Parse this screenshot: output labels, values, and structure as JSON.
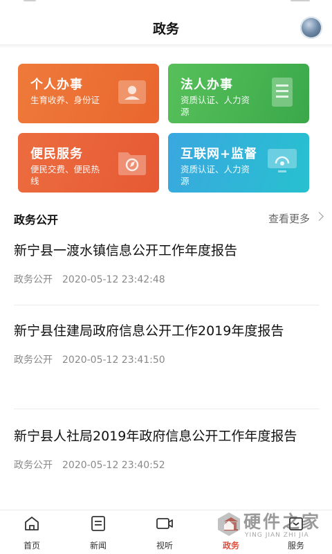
{
  "header": {
    "title": "政务"
  },
  "cards": [
    {
      "title": "个人办事",
      "subtitle": "生育收养、身份证",
      "icon": "id-card-icon",
      "color": "#ec6f35"
    },
    {
      "title": "法人办事",
      "subtitle": "资质认证、人力资源",
      "icon": "document-icon",
      "color": "#4ab552"
    },
    {
      "title": "便民服务",
      "subtitle": "便民交费、便民热线",
      "icon": "folder-compass-icon",
      "color": "#e8613a"
    },
    {
      "title": "互联网+监督",
      "subtitle": "资质认证、人力资源",
      "icon": "monitor-icon",
      "color": "#31b3d8"
    }
  ],
  "section": {
    "title": "政务公开",
    "more": "查看更多",
    "more_icon": "chevron-right-icon"
  },
  "news": [
    {
      "title": "新宁县一渡水镇信息公开工作年度报告",
      "category": "政务公开",
      "time": "2020-05-12 23:42:48"
    },
    {
      "title": "新宁县住建局政府信息公开工作2019年度报告",
      "category": "政务公开",
      "time": "2020-05-12 23:41:50"
    },
    {
      "title": "新宁县人社局2019年政府信息公开工作年度报告",
      "category": "政务公开",
      "time": "2020-05-12 23:40:52"
    }
  ],
  "tabs": [
    {
      "label": "首页",
      "icon": "home-icon",
      "active": false
    },
    {
      "label": "新闻",
      "icon": "news-icon",
      "active": false
    },
    {
      "label": "视听",
      "icon": "video-icon",
      "active": false
    },
    {
      "label": "政务",
      "icon": "government-icon",
      "active": true
    },
    {
      "label": "服务",
      "icon": "service-icon",
      "active": false
    }
  ],
  "watermark": {
    "text": "硬件之家",
    "sub": "YING JIAN ZHI JIA"
  },
  "colors": {
    "accent": "#e24b3a"
  }
}
